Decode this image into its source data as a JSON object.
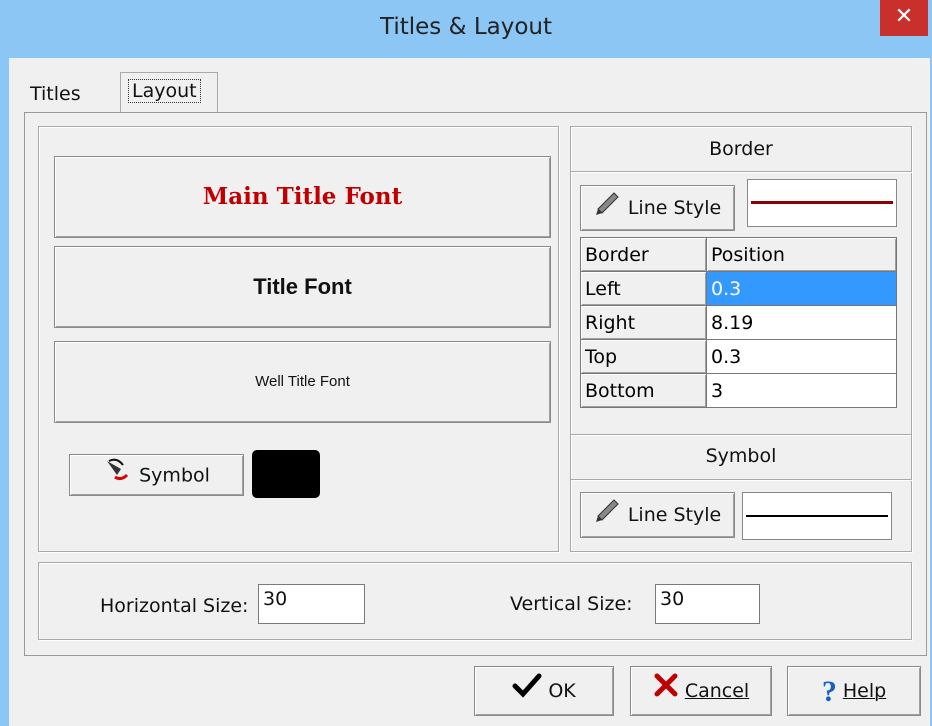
{
  "window": {
    "title": "Titles & Layout",
    "close_glyph": "✕"
  },
  "tabs": [
    {
      "label": "Titles",
      "active": false
    },
    {
      "label": "Layout",
      "active": true
    }
  ],
  "fonts": {
    "main_title": "Main Title Font",
    "title": "Title Font",
    "well_title": "Well Title Font",
    "main_title_color": "#c00000"
  },
  "symbol": {
    "button_label": "Symbol",
    "icon": "symbol-picker-icon",
    "color": "#000000"
  },
  "border": {
    "section_label": "Border",
    "line_style_label": "Line Style",
    "line_style_icon": "pencil-icon",
    "line_color": "#8b0000",
    "table": {
      "headers": [
        "Border",
        "Position"
      ],
      "rows": [
        {
          "name": "Left",
          "value": "0.3",
          "selected": true
        },
        {
          "name": "Right",
          "value": "8.19",
          "selected": false
        },
        {
          "name": "Top",
          "value": "0.3",
          "selected": false
        },
        {
          "name": "Bottom",
          "value": "3",
          "selected": false
        }
      ]
    }
  },
  "symbol_section": {
    "section_label": "Symbol",
    "line_style_label": "Line Style",
    "line_style_icon": "pencil-icon",
    "line_color": "#000000"
  },
  "size": {
    "horizontal_label": "Horizontal Size:",
    "horizontal_value": "30",
    "vertical_label": "Vertical Size:",
    "vertical_value": "30"
  },
  "buttons": {
    "ok": "OK",
    "cancel": "Cancel",
    "help": "Help"
  }
}
